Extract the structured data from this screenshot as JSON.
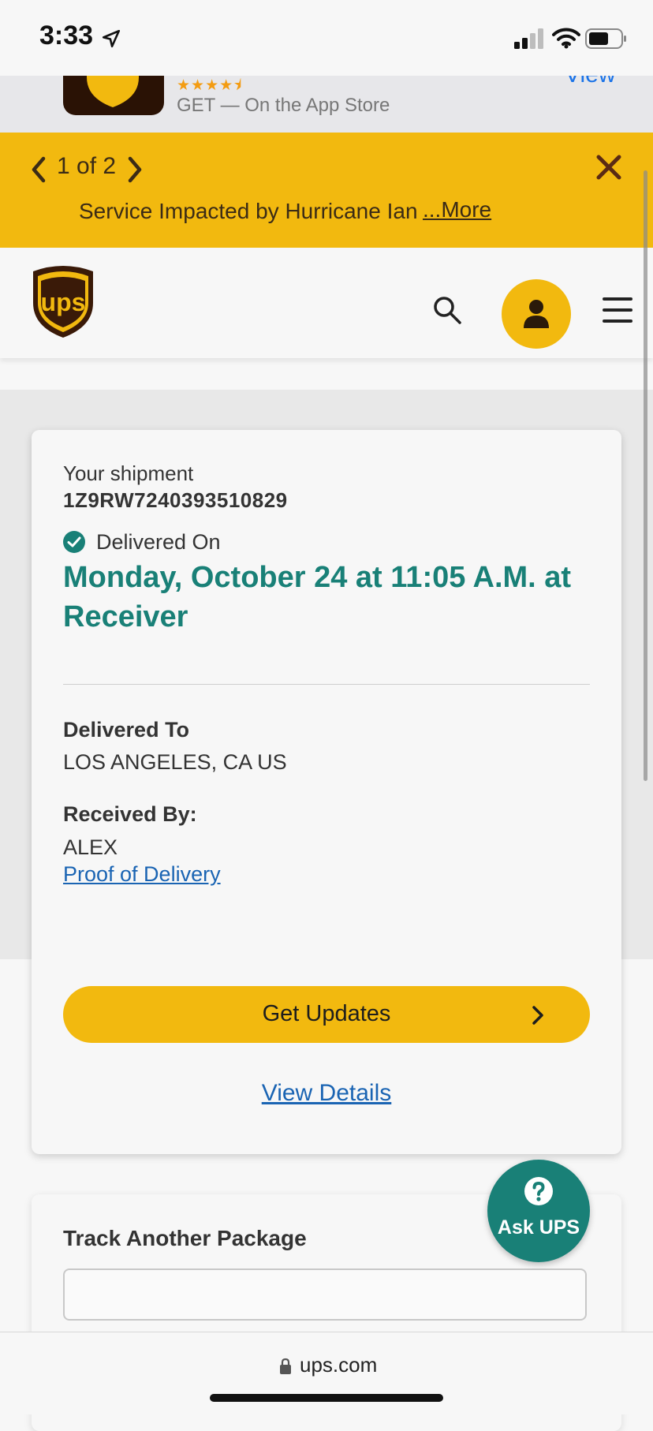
{
  "status_bar": {
    "time": "3:33"
  },
  "app_banner": {
    "rating_stars": "★★★★⯨",
    "text": "GET — On the App Store",
    "view_label": "View"
  },
  "alert": {
    "count": "1 of 2",
    "message": "Service Impacted by Hurricane Ian",
    "more_label": "...More",
    "color": "#f2b90f"
  },
  "header": {
    "brand": "ups",
    "brand_color": "#f2b90f"
  },
  "shipment": {
    "label": "Your shipment",
    "tracking_number": "1Z9RW7240393510829",
    "status_label": "Delivered On",
    "delivered_date": "Monday, October 24 at 11:05 A.M. at Receiver",
    "delivered_to_label": "Delivered To",
    "delivered_to_value": "LOS ANGELES, CA US",
    "received_by_label": "Received By:",
    "received_by_value": "ALEX",
    "proof_link": "Proof of Delivery",
    "get_updates_label": "Get Updates",
    "view_details_label": "View Details",
    "accent_color": "#198077"
  },
  "track_another": {
    "title": "Track Another Package",
    "input_value": ""
  },
  "ask_ups": {
    "label": "Ask UPS"
  },
  "browser": {
    "url": "ups.com"
  }
}
